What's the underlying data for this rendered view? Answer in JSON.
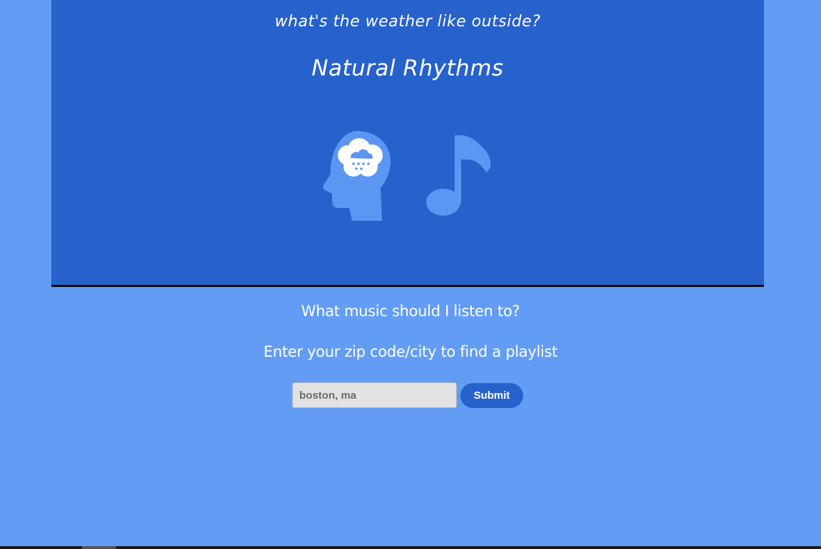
{
  "hero": {
    "tagline": "what's the weather like outside?",
    "title": "Natural Rhythms",
    "icons": {
      "head": "head-with-rain-cloud-icon",
      "note": "music-note-icon"
    }
  },
  "prompt": {
    "question": "What music should I listen to?",
    "instruction": "Enter your zip code/city to find a playlist"
  },
  "search": {
    "placeholder": "boston, ma",
    "value": "",
    "submit_label": "Submit"
  },
  "colors": {
    "background": "#639cf5",
    "hero": "#2761cc",
    "icon": "#5b97f2",
    "input": "#e2e2e2",
    "button": "#2761cc"
  }
}
